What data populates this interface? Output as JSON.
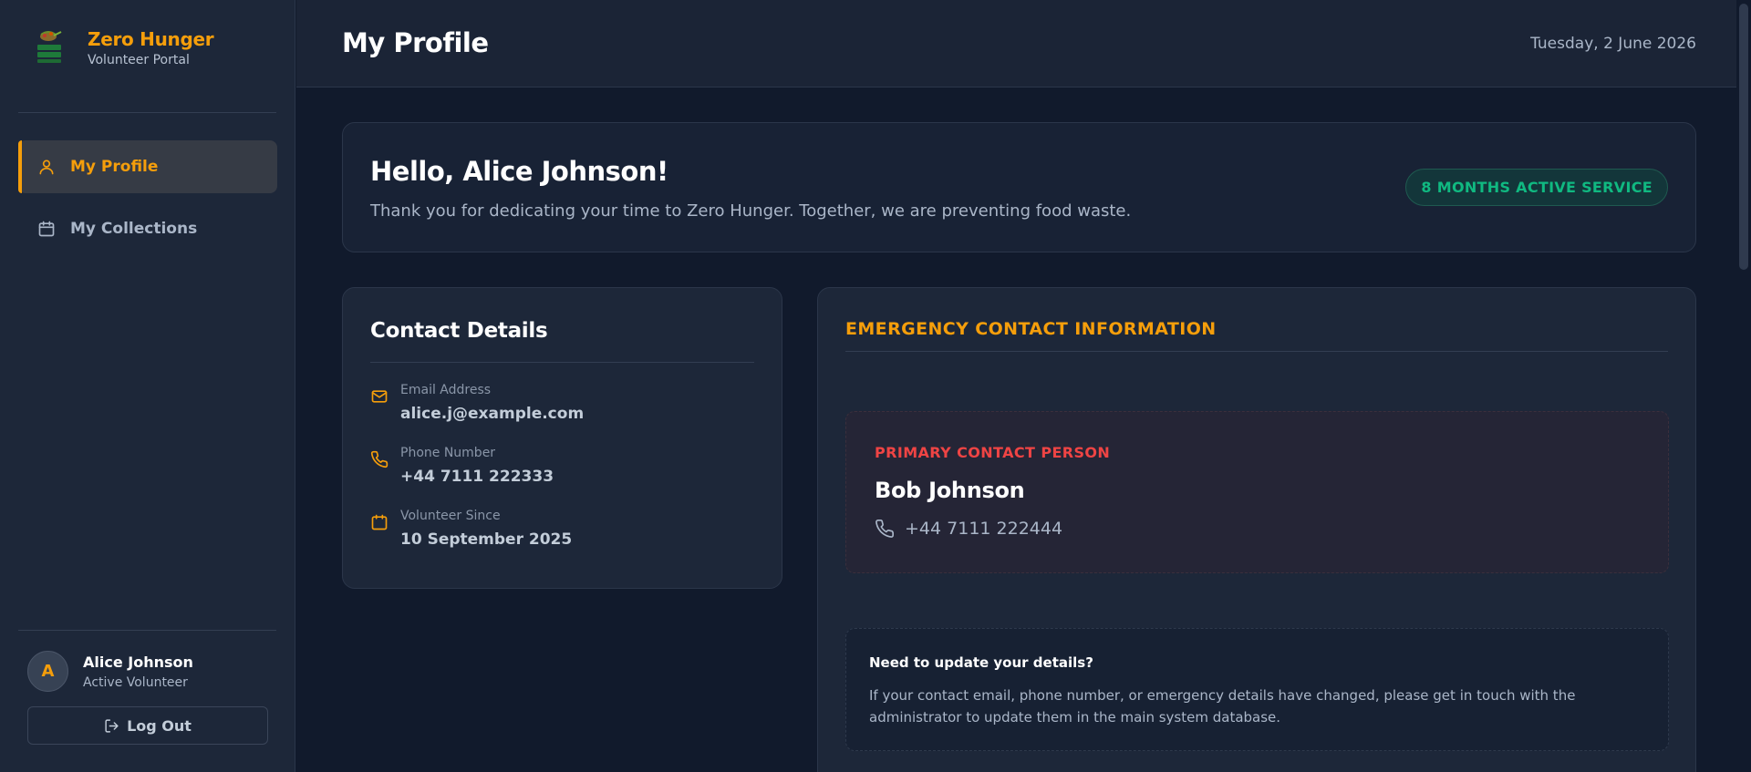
{
  "brand": {
    "name": "Zero Hunger",
    "subtitle": "Volunteer Portal",
    "logo_icon": "zero-hunger-logo"
  },
  "nav": {
    "items": [
      {
        "label": "My Profile",
        "icon": "user-icon",
        "active": true
      },
      {
        "label": "My Collections",
        "icon": "calendar-icon",
        "active": false
      }
    ]
  },
  "user": {
    "initial": "A",
    "name": "Alice Johnson",
    "role": "Active Volunteer",
    "logout_label": "Log Out"
  },
  "header": {
    "title": "My Profile",
    "date": "Tuesday, 2 June 2026"
  },
  "hello": {
    "title": "Hello, Alice Johnson!",
    "subtitle": "Thank you for dedicating your time to Zero Hunger. Together, we are preventing food waste.",
    "badge": "8 MONTHS ACTIVE SERVICE"
  },
  "contact": {
    "title": "Contact Details",
    "fields": [
      {
        "label": "Email Address",
        "value": "alice.j@example.com",
        "icon": "mail-icon"
      },
      {
        "label": "Phone Number",
        "value": "+44 7111 222333",
        "icon": "phone-icon"
      },
      {
        "label": "Volunteer Since",
        "value": "10 September 2025",
        "icon": "calendar-icon"
      }
    ]
  },
  "emergency": {
    "title": "EMERGENCY CONTACT INFORMATION",
    "primary_label": "PRIMARY CONTACT PERSON",
    "primary_name": "Bob Johnson",
    "primary_phone": "+44 7111 222444",
    "update_title": "Need to update your details?",
    "update_text": "If your contact email, phone number, or emergency details have changed, please get in touch with the administrator to update them in the main system database."
  },
  "colors": {
    "accent": "#f59e0b",
    "success": "#10b981",
    "danger": "#ef4444",
    "background": "#111a2c",
    "sidebar": "#1d2739"
  }
}
